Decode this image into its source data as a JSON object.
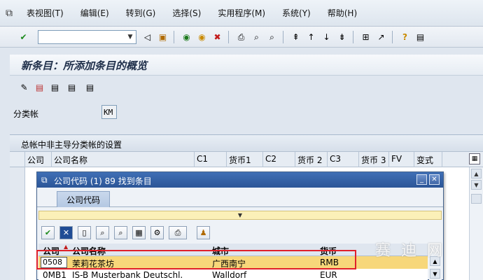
{
  "menu": {
    "items": [
      "表视图(T)",
      "编辑(E)",
      "转到(G)",
      "选择(S)",
      "实用程序(M)",
      "系统(Y)",
      "帮助(H)"
    ]
  },
  "toolbar": {
    "command_value": "",
    "icons": [
      "enter-icon",
      "back-icon",
      "save-icon",
      "exit-icon",
      "cancel-icon",
      "print-icon",
      "find-icon",
      "find-next-icon",
      "first-page-icon",
      "prev-page-icon",
      "next-page-icon",
      "last-page-icon",
      "new-session-icon",
      "shortcut-icon",
      "help-icon",
      "customize-icon"
    ]
  },
  "screen": {
    "title": "新条目：所添加条目的概览",
    "ledger_label": "分类帐",
    "ledger_value": "KM"
  },
  "table": {
    "title": "总帐中非主导分类帐的设置",
    "columns": [
      "公司",
      "公司名称",
      "C1",
      "货币1",
      "C2",
      "货币 2",
      "C3",
      "货币 3",
      "FV",
      "变式"
    ]
  },
  "dialog": {
    "title": "公司代码 (1)  89 找到条目",
    "tab_label": "公司代码",
    "columns": [
      "公司",
      "公司名称",
      "城市",
      "货币"
    ],
    "rows": [
      {
        "code": "0508",
        "name": "茉莉花茶坊",
        "city": "广西南宁",
        "currency": "RMB"
      },
      {
        "code": "0MB1",
        "name": "IS-B Musterbank Deutschl.",
        "city": "Walldorf",
        "currency": "EUR"
      }
    ]
  },
  "watermark": "赛 迪 网"
}
